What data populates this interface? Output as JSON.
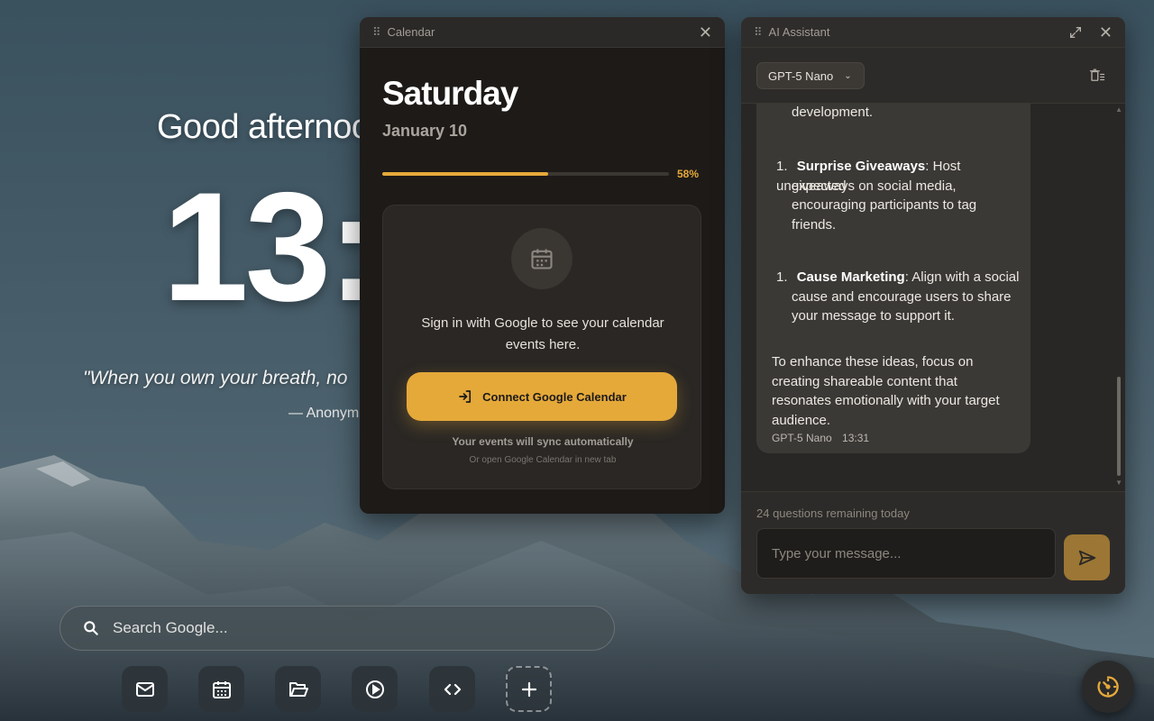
{
  "background": {
    "description_icon": "mountain-landscape"
  },
  "greeting": {
    "text": "Good afternoo"
  },
  "clock": {
    "time": "13:"
  },
  "quote": {
    "text": "\"When you own your breath, no",
    "author": "— Anonym"
  },
  "search": {
    "placeholder": "Search Google..."
  },
  "dock": {
    "items": [
      {
        "icon": "mail-icon"
      },
      {
        "icon": "calendar-icon"
      },
      {
        "icon": "folder-icon"
      },
      {
        "icon": "play-icon"
      },
      {
        "icon": "code-icon"
      },
      {
        "icon": "plus-icon"
      }
    ]
  },
  "calendar": {
    "title": "Calendar",
    "close": "✕",
    "day": "Saturday",
    "date": "January 10",
    "progress": 0.58,
    "progress_label": "58%",
    "message": "Sign in with Google to see your calendar events here.",
    "connect_label": "Connect Google Calendar",
    "sync_text": "Your events will sync automatically",
    "open_text": "Or open Google Calendar in new tab"
  },
  "assistant": {
    "title": "AI Assistant",
    "close": "✕",
    "model": "GPT-5 Nano",
    "chat": {
      "top_fragment": "development.",
      "items": [
        {
          "num": "1.",
          "bold": "Surprise Giveaways",
          "rest_lines": [
            ": Host unexpected",
            "giveaways on social media,",
            "encouraging participants to tag",
            "friends."
          ]
        },
        {
          "num": "1.",
          "bold": "Cause Marketing",
          "rest_lines": [
            ": Align with a social",
            "cause and encourage users to share",
            "your message to support it."
          ]
        }
      ],
      "paragraph_lines": [
        "To enhance these ideas, focus on",
        "creating shareable content that",
        "resonates emotionally with your target",
        "audience."
      ],
      "meta_model": "GPT-5 Nano",
      "meta_time": "13:31"
    },
    "remaining": "24 questions remaining today",
    "input_placeholder": "Type your message..."
  },
  "colors": {
    "accent": "#e5a93a",
    "panel_bg": "#1d1a18",
    "assistant_bg": "#2a2826"
  }
}
